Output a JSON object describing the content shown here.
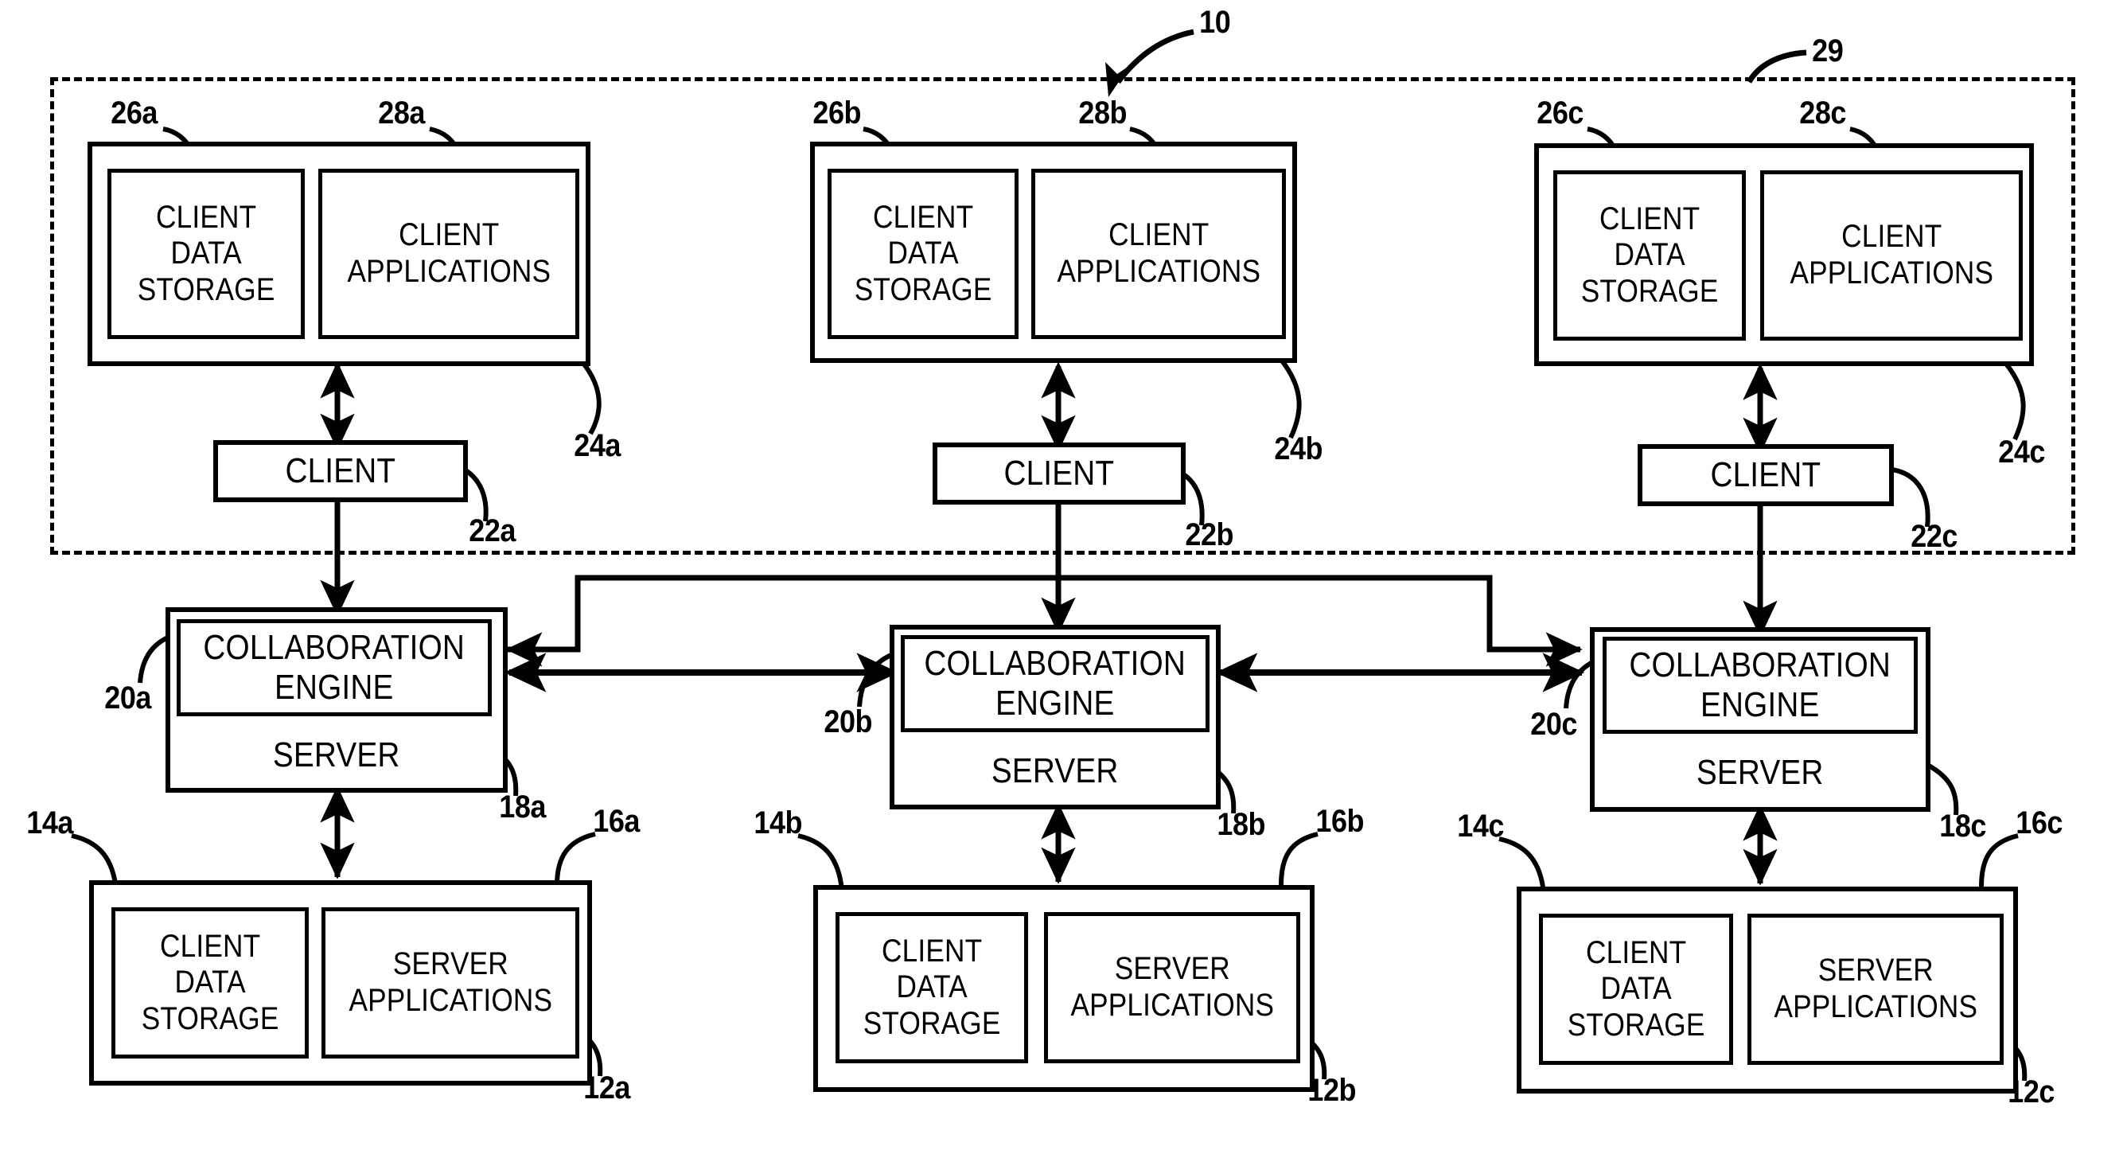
{
  "figure": {
    "title": "Collaboration system network architecture patent diagram",
    "overall_ref": "10",
    "zone_ref": "29",
    "line_color": "#000000",
    "background_color": "#ffffff"
  },
  "labels": {
    "client_data_storage": "CLIENT\nDATA\nSTORAGE",
    "client_applications": "CLIENT\nAPPLICATIONS",
    "server_applications": "SERVER\nAPPLICATIONS",
    "client": "CLIENT",
    "collaboration_engine": "COLLABORATION\nENGINE",
    "server": "SERVER"
  },
  "columns": [
    {
      "id": "a",
      "client_machine_ref": "24a",
      "client_data_storage_ref": "26a",
      "client_applications_ref": "28a",
      "client_ref": "22a",
      "collaboration_engine_ref": "20a",
      "server_ref": "18a",
      "server_storage_group_ref": "12a",
      "server_client_data_storage_ref": "14a",
      "server_applications_ref": "16a"
    },
    {
      "id": "b",
      "client_machine_ref": "24b",
      "client_data_storage_ref": "26b",
      "client_applications_ref": "28b",
      "client_ref": "22b",
      "collaboration_engine_ref": "20b",
      "server_ref": "18b",
      "server_storage_group_ref": "12b",
      "server_client_data_storage_ref": "14b",
      "server_applications_ref": "16b"
    },
    {
      "id": "c",
      "client_machine_ref": "24c",
      "client_data_storage_ref": "26c",
      "client_applications_ref": "28c",
      "client_ref": "22c",
      "collaboration_engine_ref": "20c",
      "server_ref": "18c",
      "server_storage_group_ref": "12c",
      "server_client_data_storage_ref": "14c",
      "server_applications_ref": "16c"
    }
  ]
}
